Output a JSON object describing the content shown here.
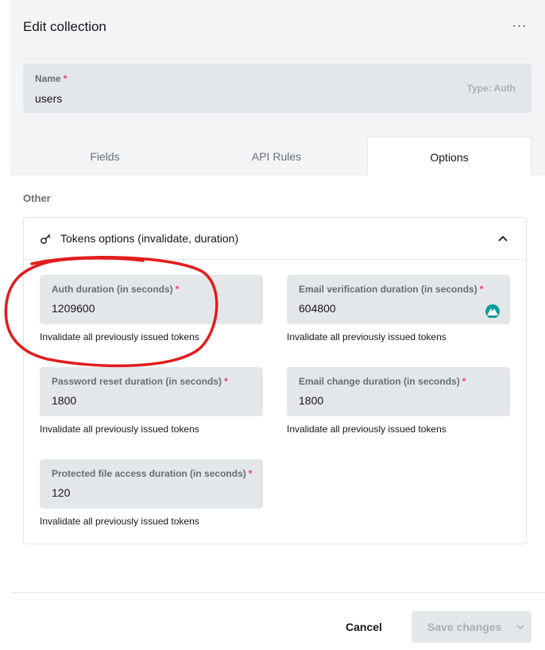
{
  "header": {
    "title": "Edit collection",
    "more_label": "···"
  },
  "name_field": {
    "label": "Name",
    "required_mark": "*",
    "value": "users",
    "type_note": "Type: Auth"
  },
  "tabs": [
    {
      "label": "Fields"
    },
    {
      "label": "API Rules"
    },
    {
      "label": "Options"
    }
  ],
  "section": {
    "label": "Other"
  },
  "tokens_options": {
    "title": "Tokens options (invalidate, duration)",
    "fields": [
      {
        "label": "Auth duration (in seconds)",
        "value": "1209600",
        "hint": "Invalidate all previously issued tokens"
      },
      {
        "label": "Email verification duration (in seconds)",
        "value": "604800",
        "hint": "Invalidate all previously issued tokens"
      },
      {
        "label": "Password reset duration (in seconds)",
        "value": "1800",
        "hint": "Invalidate all previously issued tokens"
      },
      {
        "label": "Email change duration (in seconds)",
        "value": "1800",
        "hint": "Invalidate all previously issued tokens"
      },
      {
        "label": "Protected file access duration (in seconds)",
        "value": "120",
        "hint": "Invalidate all previously issued tokens"
      }
    ]
  },
  "footer": {
    "cancel_label": "Cancel",
    "save_label": "Save changes"
  },
  "colors": {
    "panel_bg": "#f3f4f5",
    "field_bg": "#e4e7ea",
    "required": "#e34562",
    "annotation": "#e11d1d",
    "ext_icon": "#0f9b9b"
  }
}
